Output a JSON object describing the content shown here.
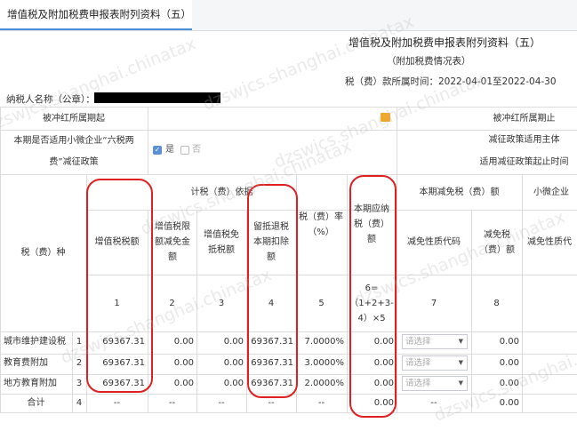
{
  "tab": {
    "title": "增值税及附加税费申报表附列资料（五）"
  },
  "form": {
    "title": "增值税及附加税费申报表附列资料（五）",
    "subtitle": "（附加税费情况表）",
    "period": "税（费）款所属时间：2022-04-01至2022-04-30",
    "taxpayer_label": "纳税人名称（公章）："
  },
  "rows_top": {
    "cancel_start": "被冲红所属期起",
    "cancel_end": "被冲红所属期止",
    "small_q1": "本期是否适用小微企业“六税两",
    "small_q2": "费”减征政策",
    "yes": "是",
    "no": "否",
    "policy_subject": "减征政策适用主体",
    "policy_start": "适用减征政策起止时间"
  },
  "headers": {
    "tax_type": "税（费）种",
    "basis": "计税（费）依据",
    "vat_amount": "增值税税额",
    "vat_limit": "增值税限额减免金额",
    "vat_exempt": "增值税免抵税额",
    "retained_credit": "留抵退税本期扣除额",
    "rate": "税（费）率（%）",
    "payable": "本期应纳税（费）额",
    "reduction": "本期减免税（费）额",
    "reduction_code": "减免性质代码",
    "reduction_amount": "减免税（费）额",
    "small_enterprise": "小微企业",
    "reduction_code2": "减免性质代",
    "col1": "1",
    "col2": "2",
    "col3": "3",
    "col4": "4",
    "col5": "5",
    "col6": "6=（1+2+3-4）×5",
    "col7": "7",
    "col8": "8"
  },
  "table": {
    "rows": [
      {
        "name": "城市维护建设税",
        "no": "1",
        "vat": "69367.31",
        "limit": "0.00",
        "exempt": "0.00",
        "retained": "69367.31",
        "rate": "7.0000%",
        "payable": "0.00",
        "code": "请选择",
        "amount": "0.00"
      },
      {
        "name": "教育费附加",
        "no": "2",
        "vat": "69367.31",
        "limit": "0.00",
        "exempt": "0.00",
        "retained": "69367.31",
        "rate": "3.0000%",
        "payable": "0.00",
        "code": "请选择",
        "amount": "0.00"
      },
      {
        "name": "地方教育附加",
        "no": "3",
        "vat": "69367.31",
        "limit": "0.00",
        "exempt": "0.00",
        "retained": "69367.31",
        "rate": "2.0000%",
        "payable": "0.00",
        "code": "请选择",
        "amount": "0.00"
      }
    ],
    "total": {
      "name": "合计",
      "no": "4",
      "vat": "--",
      "limit": "--",
      "exempt": "--",
      "retained": "--",
      "rate": "--",
      "payable": "0.00",
      "code": "--",
      "amount": "0.00"
    }
  },
  "watermark": "dzswjcs.shanghai.chinatax"
}
